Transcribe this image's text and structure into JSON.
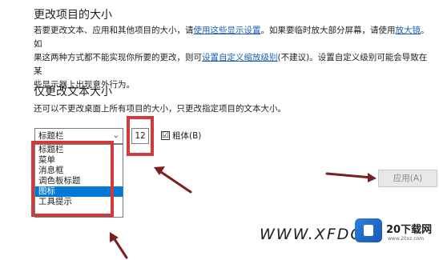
{
  "section1": {
    "heading": "更改项目的大小",
    "line1_a": "若要更改文本、应用和其他项目的大小，请",
    "line1_link1": "使用这些显示设置",
    "line1_b": "。如果要临时放大部分屏幕，请使用",
    "line1_link2": "放大镜",
    "line1_c": "。如",
    "line2_a": "果这两种方式都不能实现你所要的更改，则可",
    "line2_link": "设置自定义缩放级别",
    "line2_b": "(不建议)。设置自定义级别可能会导致在某",
    "line3": "些显示器上出现意外行为。"
  },
  "section2": {
    "heading": "仅更改文本大小",
    "description": "还可以不更改桌面上所有项目的大小，只更改指定项目的文本大小。",
    "select": {
      "value": "标题栏",
      "options": [
        "标题栏",
        "菜单",
        "消息框",
        "调色板标题",
        "图标",
        "工具提示"
      ],
      "highlighted_index": 4
    },
    "font_size": "12",
    "bold_label": "粗体(B)",
    "bold_checked": "☑",
    "apply_label": "应用(A)"
  },
  "icons": {
    "dropdown": "chevron-down-icon",
    "checkbox": "checkbox-icon"
  },
  "colors": {
    "highlight": "#d03a3a",
    "selection": "#0078d7",
    "link": "#1a5fb4"
  },
  "watermark": {
    "text": "WWW.XFDC",
    "logo_text": "20下载网",
    "logo_sub": "www.20xz.com"
  }
}
